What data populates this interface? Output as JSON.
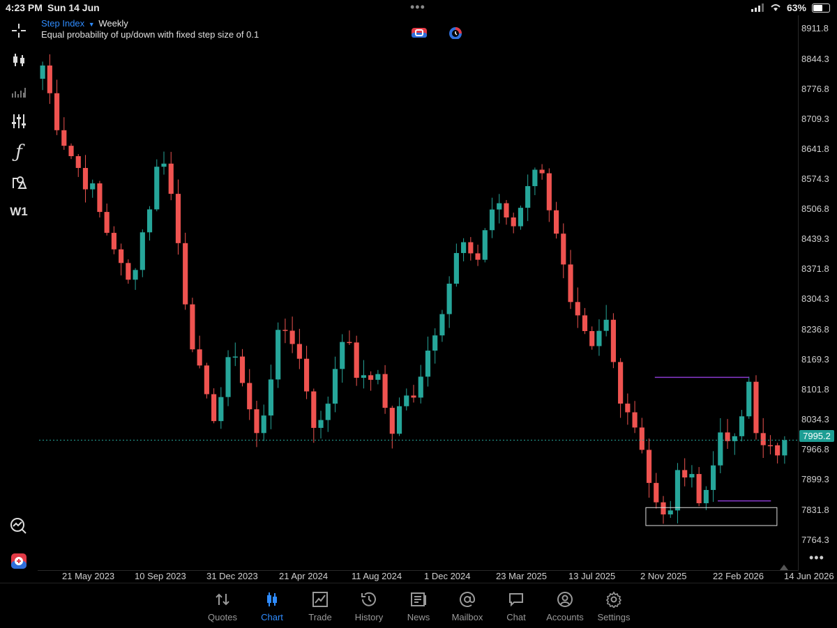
{
  "status_bar": {
    "time": "4:23 PM",
    "date": "Sun 14 Jun",
    "battery": "63%"
  },
  "chart_header": {
    "symbol": "Step Index",
    "timeframe": "Weekly",
    "description": "Equal probability of up/down with fixed step size of 0.1",
    "timeframe_badge": "W1"
  },
  "chart_data": {
    "type": "candlestick",
    "y_ticks": [
      "8911.8",
      "8844.3",
      "8776.8",
      "8709.3",
      "8641.8",
      "8574.3",
      "8506.8",
      "8439.3",
      "8371.8",
      "8304.3",
      "8236.8",
      "8169.3",
      "8101.8",
      "8034.3",
      "7966.8",
      "7899.3",
      "7831.8",
      "7764.3"
    ],
    "x_ticks": [
      "21 May 2023",
      "10 Sep 2023",
      "31 Dec 2023",
      "21 Apr 2024",
      "11 Aug 2024",
      "1 Dec 2024",
      "23 Mar 2025",
      "13 Jul 2025",
      "2 Nov 2025",
      "22 Feb 2026",
      "14 Jun 2026"
    ],
    "current_price": "7995.2",
    "ylim": [
      7715,
      8935
    ],
    "up_color": "#26a69a",
    "down_color": "#ef5350",
    "level_color": "#8a3ad0",
    "anchors": [
      8830,
      8720,
      8650,
      8600,
      8560,
      8480,
      8430,
      8330,
      8420,
      8530,
      8650,
      8500,
      8300,
      8150,
      8040,
      8100,
      8210,
      8090,
      7990,
      8140,
      8250,
      8220,
      8120,
      8000,
      8100,
      8240,
      8160,
      8110,
      8160,
      8000,
      8070,
      8110,
      8180,
      8270,
      8350,
      8440,
      8370,
      8470,
      8540,
      8450,
      8520,
      8620,
      8560,
      8460,
      8290,
      8230,
      8180,
      8270,
      8120,
      8060,
      8000,
      7860,
      7810,
      7900,
      7960,
      7830,
      7960,
      8000,
      7980,
      8130,
      7970,
      7960,
      7995
    ],
    "levels": [
      {
        "price": 8135,
        "from": 0.822,
        "to": 0.948
      },
      {
        "price": 7860,
        "from": 0.906,
        "to": 0.977
      }
    ],
    "zone": {
      "top": 7845,
      "bottom": 7805,
      "from": 0.81,
      "to": 0.985
    }
  },
  "tabs": [
    {
      "label": "Quotes",
      "icon": "quotes-icon",
      "active": false
    },
    {
      "label": "Chart",
      "icon": "chart-icon",
      "active": true
    },
    {
      "label": "Trade",
      "icon": "trade-icon",
      "active": false
    },
    {
      "label": "History",
      "icon": "history-icon",
      "active": false
    },
    {
      "label": "News",
      "icon": "news-icon",
      "active": false
    },
    {
      "label": "Mailbox",
      "icon": "mailbox-icon",
      "active": false
    },
    {
      "label": "Chat",
      "icon": "chat-icon",
      "active": false
    },
    {
      "label": "Accounts",
      "icon": "accounts-icon",
      "active": false
    },
    {
      "label": "Settings",
      "icon": "settings-icon",
      "active": false
    }
  ]
}
